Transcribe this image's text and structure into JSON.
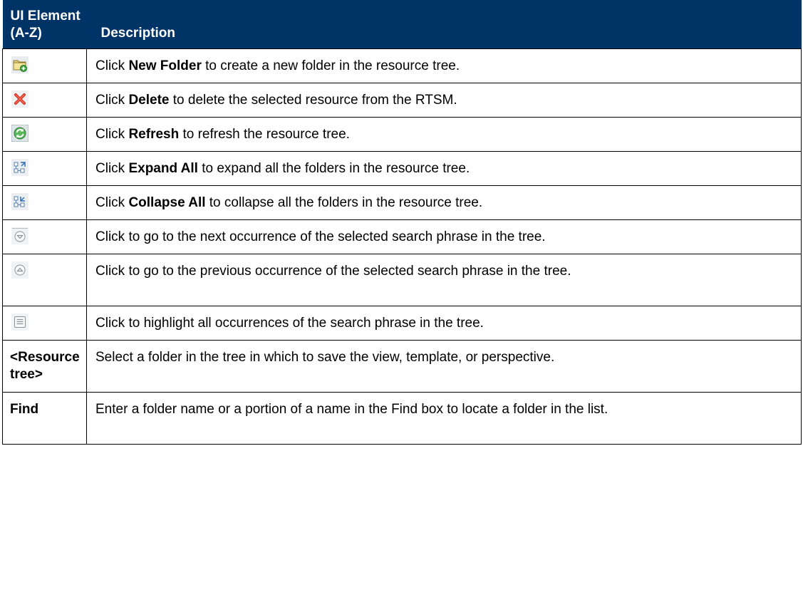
{
  "header": {
    "col1": "UI Element (A-Z)",
    "col2": "Description"
  },
  "rows": [
    {
      "icon": "new-folder-icon",
      "pre": "Click ",
      "bold": "New Folder",
      "post": " to create a new folder in the resource tree."
    },
    {
      "icon": "delete-icon",
      "pre": "Click ",
      "bold": "Delete",
      "post": " to delete the selected resource from the RTSM."
    },
    {
      "icon": "refresh-icon",
      "pre": "Click ",
      "bold": "Refresh",
      "post": " to refresh the resource tree."
    },
    {
      "icon": "expand-all-icon",
      "pre": "Click ",
      "bold": "Expand All",
      "post": " to expand all the folders in the resource tree."
    },
    {
      "icon": "collapse-all-icon",
      "pre": "Click ",
      "bold": "Collapse All",
      "post": " to collapse all the folders in the resource tree."
    },
    {
      "icon": "next-occurrence-icon",
      "text": "Click to go to the next occurrence of the selected search phrase in the tree."
    },
    {
      "icon": "previous-occurrence-icon",
      "text": "Click to go to the previous occurrence of the selected search phrase in the tree."
    },
    {
      "icon": "highlight-all-icon",
      "text": "Click to highlight all occurrences of the search phrase in the tree."
    },
    {
      "term": "<Resource tree>",
      "text": "Select a folder in the tree in which to save the view, template, or perspective."
    },
    {
      "term": "Find",
      "text": "Enter a folder name or a portion of a name in the Find box to locate a folder in the list."
    }
  ]
}
